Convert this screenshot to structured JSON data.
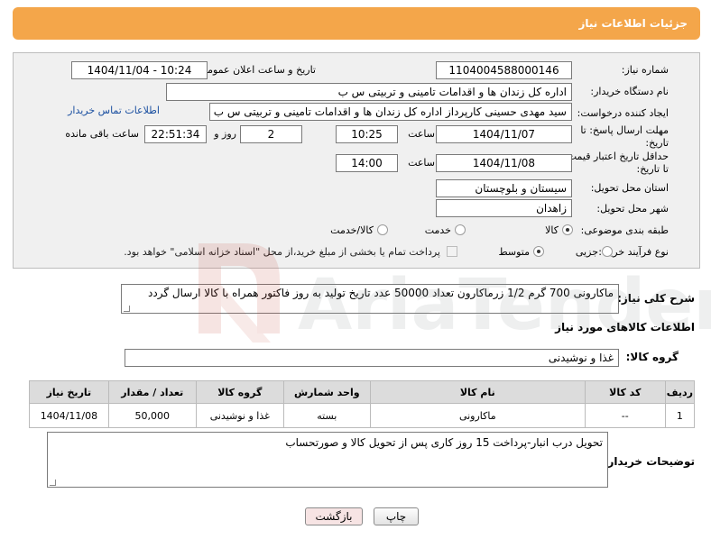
{
  "header": {
    "title": "جزئیات اطلاعات نیاز"
  },
  "form": {
    "need_number_label": "شماره نیاز:",
    "need_number": "1104004588000146",
    "announce_label": "تاریخ و ساعت اعلان عمومی:",
    "announce_value": "1404/11/04 - 10:24",
    "buyer_org_label": "نام دستگاه خریدار:",
    "buyer_org": "اداره کل زندان ها و اقدامات تامینی و تربیتی س ب",
    "creator_label": "ایجاد کننده درخواست:",
    "creator": "سید مهدی حسینی کارپرداز اداره کل زندان ها و اقدامات تامینی و تربیتی س ب",
    "contact_link": "اطلاعات تماس خریدار",
    "reply_deadline_label_1": "مهلت ارسال پاسخ: تا",
    "reply_deadline_label_2": "تاریخ:",
    "reply_date": "1404/11/07",
    "time_label": "ساعت",
    "reply_time": "10:25",
    "days_value": "2",
    "days_label": "روز و",
    "remaining_time": "22:51:34",
    "remaining_label": "ساعت باقی مانده",
    "price_deadline_label_1": "حداقل تاریخ اعتبار قیمت:",
    "price_deadline_label_2": "تا تاریخ:",
    "price_date": "1404/11/08",
    "price_time": "14:00",
    "province_label": "استان محل تحویل:",
    "province": "سیستان و بلوچستان",
    "city_label": "شهر محل تحویل:",
    "city": "زاهدان",
    "category_label": "طبقه بندی موضوعی:",
    "category_options": [
      "کالا",
      "خدمت",
      "کالا/خدمت"
    ],
    "process_label": "نوع فرآیند خرید :",
    "process_options": [
      "جزیی",
      "متوسط"
    ],
    "payment_note": "پرداخت تمام یا بخشی از مبلغ خرید،از محل \"اسناد خزانه اسلامی\" خواهد بود."
  },
  "description": {
    "label": "شرح کلی نیاز:",
    "text": "ماکارونی 700 گرم 1/2 زرماکارون تعداد 50000 عدد تاریخ تولید به روز فاکتور همراه با کالا ارسال گردد"
  },
  "goods": {
    "section_title": "اطلاعات کالاهای مورد نیاز",
    "group_label": "گروه کالا:",
    "group_value": "غذا و نوشیدنی",
    "columns": [
      "ردیف",
      "کد کالا",
      "نام کالا",
      "واحد شمارش",
      "گروه کالا",
      "تعداد / مقدار",
      "تاریخ نیاز"
    ],
    "rows": [
      [
        "1",
        "--",
        "ماکارونی",
        "بسته",
        "غذا و نوشیدنی",
        "50,000",
        "1404/11/08"
      ]
    ]
  },
  "buyer_notes": {
    "label": "توضیحات خریدار:",
    "text": "تحویل درب انبار-پرداخت 15 روز کاری پس از تحویل کالا و صورتحساب"
  },
  "buttons": {
    "print": "چاپ",
    "back": "بازگشت"
  },
  "watermark": {
    "text": "AriaTender.net"
  },
  "colors": {
    "header": "#f4a64a",
    "link": "#1a4fa0"
  }
}
